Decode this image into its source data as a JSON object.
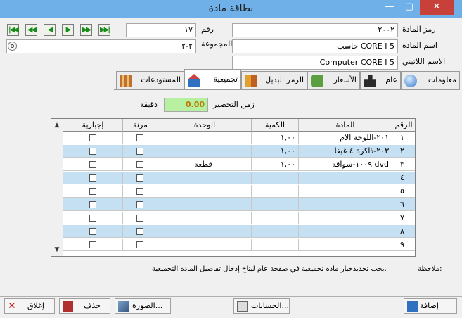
{
  "window": {
    "title": "بطاقة مادة",
    "close": "✕",
    "maximize": "▢",
    "minimize": "—"
  },
  "nav": [
    "▶▶|",
    "▶▶",
    "▶",
    "◀",
    "◀◀",
    "|◀◀"
  ],
  "header": {
    "code_label": "رمز المادة",
    "code_value": "٢٠٠٢",
    "name_label": "اسم المادة",
    "name_value": "حاسب CORE I 5",
    "latin_label": "الاسم اللاتيني",
    "latin_value": "Computer CORE I 5",
    "number_label": "رقم",
    "number_value": "١٧",
    "group_label": "المجموعة",
    "group_value": "٢-٢"
  },
  "tabs": [
    {
      "label": "معلومات"
    },
    {
      "label": "عام"
    },
    {
      "label": "الأسعار"
    },
    {
      "label": "الرمز البديل"
    },
    {
      "label": "تجميعية"
    },
    {
      "label": "المستودعات"
    }
  ],
  "prep": {
    "label": "زمن التحضير",
    "value": "0.00",
    "unit": "دقيقة"
  },
  "grid": {
    "columns": [
      "الرقم",
      "المادة",
      "الكمية",
      "الوحدة",
      "مرنة",
      "إجبارية"
    ],
    "rows": [
      {
        "num": "١",
        "item": "٢٠١-اللوحة الام",
        "qty": "١,٠٠",
        "unit": ""
      },
      {
        "num": "٢",
        "item": "٢٠٣-ذاكرة ٤ غيغا",
        "qty": "١,٠٠",
        "unit": ""
      },
      {
        "num": "٣",
        "item": "١٠٠٩-سواقة dvd",
        "qty": "١,٠٠",
        "unit": "قطعة"
      },
      {
        "num": "٤",
        "item": "",
        "qty": "",
        "unit": ""
      },
      {
        "num": "٥",
        "item": "",
        "qty": "",
        "unit": ""
      },
      {
        "num": "٦",
        "item": "",
        "qty": "",
        "unit": ""
      },
      {
        "num": "٧",
        "item": "",
        "qty": "",
        "unit": ""
      },
      {
        "num": "٨",
        "item": "",
        "qty": "",
        "unit": ""
      },
      {
        "num": "٩",
        "item": "",
        "qty": "",
        "unit": ""
      }
    ]
  },
  "note": {
    "label": "ملاحظة:",
    "text": "يجب تحديدخيار مادة تجميعية في صفحة عام ليتاح إدخال تفاصيل المادة التجميعية."
  },
  "toolbar": {
    "add": "إضافة",
    "accounts": "الحسابات...",
    "image": "الصورة...",
    "delete": "حذف",
    "close": "إغلاق"
  },
  "colors": {
    "titlebar": "#6fb0e8",
    "close_btn": "#c8403a",
    "prep_field": "#b6f0a0",
    "alt_row": "#c5dff3"
  }
}
